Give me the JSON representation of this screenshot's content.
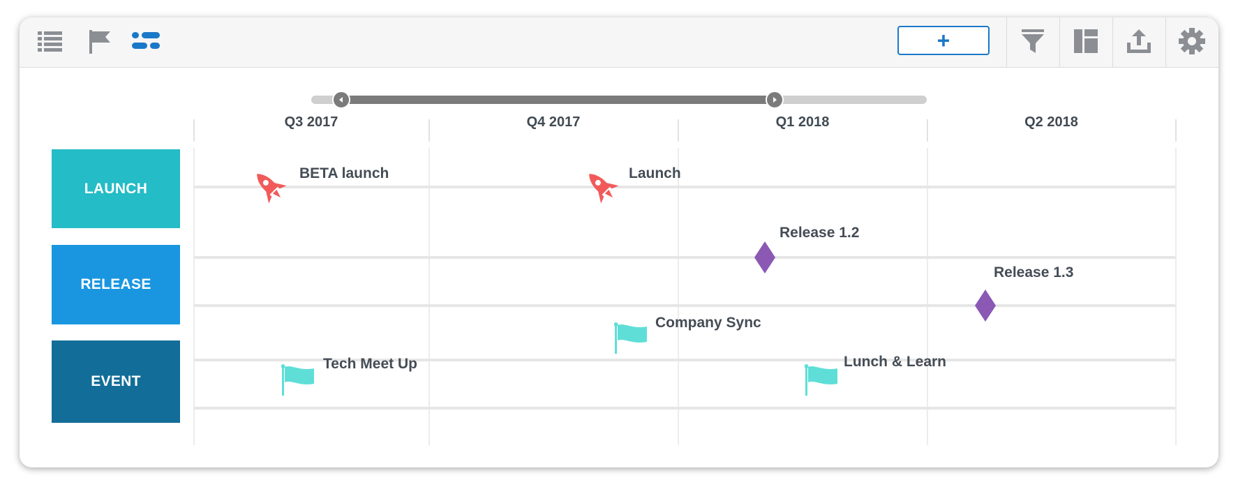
{
  "toolbar": {
    "left_icons": [
      "list-icon",
      "flag-icon",
      "timeline-icon"
    ],
    "add_label": "+",
    "right_icons": [
      "filter-icon",
      "layout-icon",
      "export-icon",
      "gear-icon"
    ],
    "accent": "#1a78c8"
  },
  "range_slider": {
    "start_fraction": 0.05,
    "end_fraction": 0.76
  },
  "quarters": [
    "Q3 2017",
    "Q4 2017",
    "Q1 2018",
    "Q2 2018"
  ],
  "swimlanes": [
    {
      "label": "LAUNCH",
      "color": "#24bcc6"
    },
    {
      "label": "RELEASE",
      "color": "#1a96e0"
    },
    {
      "label": "EVENT",
      "color": "#126e98"
    }
  ],
  "milestones": [
    {
      "label": "BETA launch",
      "icon": "rocket-icon",
      "color": "#f25a5a"
    },
    {
      "label": "Launch",
      "icon": "rocket-icon",
      "color": "#f25a5a"
    },
    {
      "label": "Release 1.2",
      "icon": "diamond-icon",
      "color": "#8b58b4"
    },
    {
      "label": "Release 1.3",
      "icon": "diamond-icon",
      "color": "#8b58b4"
    },
    {
      "label": "Company Sync",
      "icon": "flag-icon",
      "color": "#5fded8"
    },
    {
      "label": "Tech Meet Up",
      "icon": "flag-icon",
      "color": "#5fded8"
    },
    {
      "label": "Lunch & Learn",
      "icon": "flag-icon",
      "color": "#5fded8"
    }
  ]
}
